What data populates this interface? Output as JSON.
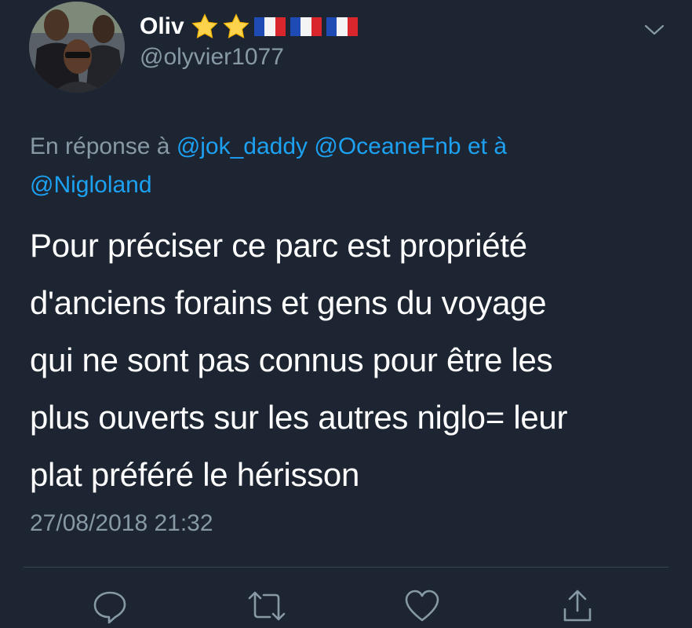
{
  "author": {
    "display_name": "Oliv",
    "handle": "@olyvier1077",
    "emojis": [
      "star",
      "star",
      "flag-france",
      "flag-france",
      "flag-france"
    ]
  },
  "reply": {
    "prefix": "En réponse à",
    "mention_1": "@jok_daddy",
    "mention_2": "@OceaneFnb",
    "conjunction": "et à",
    "mention_3": "@Nigloland"
  },
  "tweet": {
    "lines": [
      "Pour préciser ce parc est propriété",
      "d'anciens forains et gens du voyage",
      "qui ne sont pas connus pour être les",
      "plus ouverts sur les autres niglo= leur",
      "plat préféré le hérisson"
    ]
  },
  "timestamp": "27/08/2018 21:32",
  "actions": {
    "icons": [
      "reply-icon",
      "retweet-icon",
      "like-icon",
      "share-icon"
    ]
  },
  "colors": {
    "background": "#1c2531",
    "text": "#ffffff",
    "secondary": "#8899a6",
    "accent": "#1da1f2",
    "divider": "#38444d"
  }
}
